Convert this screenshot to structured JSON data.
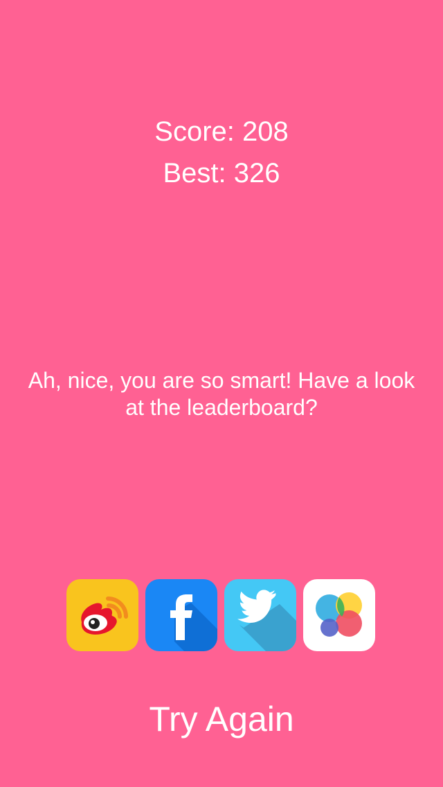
{
  "game_over": {
    "score_text": "Score: 208",
    "best_text": "Best: 326",
    "message": "Ah, nice, you are so smart! Have a look at the leaderboard?",
    "try_again_label": "Try Again"
  },
  "share_buttons": [
    {
      "icon": "weibo-icon",
      "color": "#F9C41E"
    },
    {
      "icon": "facebook-icon",
      "color": "#1A87F5"
    },
    {
      "icon": "twitter-icon",
      "color": "#44C8F5"
    },
    {
      "icon": "game-center-icon",
      "color": "#FFFFFF"
    }
  ],
  "theme": {
    "background": "#FF6193",
    "text": "#FFFFFF"
  }
}
